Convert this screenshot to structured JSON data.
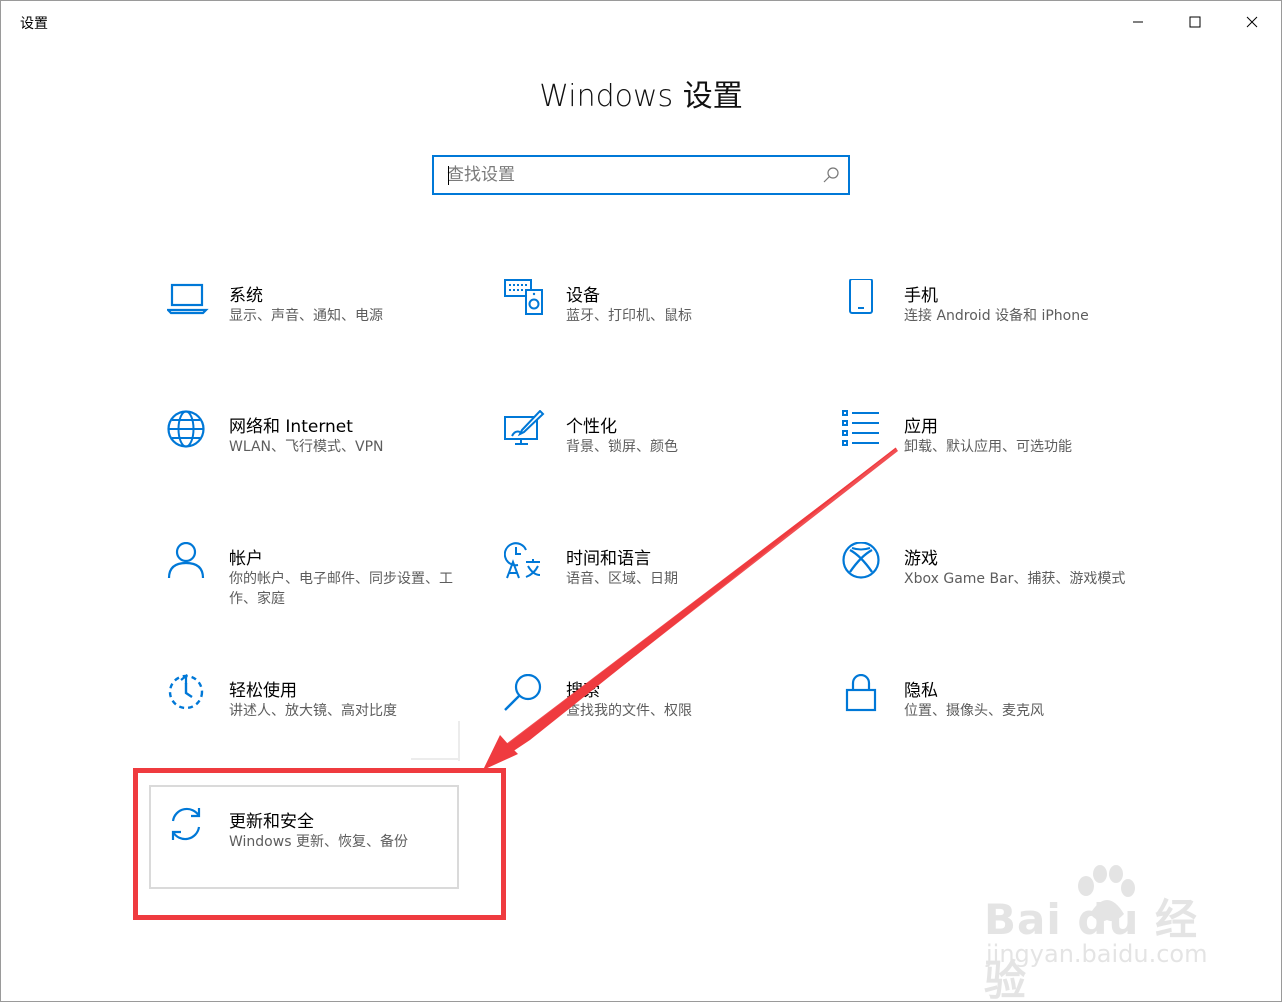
{
  "window": {
    "title": "设置",
    "controls": {
      "minimize": "minimize-icon",
      "maximize": "maximize-icon",
      "close": "close-icon"
    }
  },
  "header": {
    "title": "Windows 设置"
  },
  "search": {
    "placeholder": "查找设置",
    "value": "",
    "icon": "search-icon"
  },
  "accent_color": "#0078d7",
  "annotation_color": "#ef3b3f",
  "tiles": [
    {
      "id": "system",
      "icon": "laptop-icon",
      "title": "系统",
      "desc": "显示、声音、通知、电源"
    },
    {
      "id": "devices",
      "icon": "keyboard-speaker-icon",
      "title": "设备",
      "desc": "蓝牙、打印机、鼠标"
    },
    {
      "id": "phone",
      "icon": "phone-icon",
      "title": "手机",
      "desc": "连接 Android 设备和 iPhone"
    },
    {
      "id": "network",
      "icon": "globe-icon",
      "title": "网络和 Internet",
      "desc": "WLAN、飞行模式、VPN"
    },
    {
      "id": "personalization",
      "icon": "paint-screen-icon",
      "title": "个性化",
      "desc": "背景、锁屏、颜色"
    },
    {
      "id": "apps",
      "icon": "app-list-icon",
      "title": "应用",
      "desc": "卸载、默认应用、可选功能"
    },
    {
      "id": "accounts",
      "icon": "person-icon",
      "title": "帐户",
      "desc": "你的帐户、电子邮件、同步设置、工作、家庭"
    },
    {
      "id": "time-language",
      "icon": "clock-language-icon",
      "title": "时间和语言",
      "desc": "语音、区域、日期"
    },
    {
      "id": "gaming",
      "icon": "xbox-icon",
      "title": "游戏",
      "desc": "Xbox Game Bar、捕获、游戏模式"
    },
    {
      "id": "ease-of-access",
      "icon": "ease-of-access-icon",
      "title": "轻松使用",
      "desc": "讲述人、放大镜、高对比度"
    },
    {
      "id": "search",
      "icon": "magnifier-icon",
      "title": "搜索",
      "desc": "查找我的文件、权限"
    },
    {
      "id": "privacy",
      "icon": "lock-icon",
      "title": "隐私",
      "desc": "位置、摄像头、麦克风"
    },
    {
      "id": "update-security",
      "icon": "sync-icon",
      "title": "更新和安全",
      "desc": "Windows 更新、恢复、备份"
    }
  ],
  "watermark": {
    "main": "Bai du 经验",
    "sub": "jingyan.baidu.com",
    "icon": "paw-icon"
  }
}
